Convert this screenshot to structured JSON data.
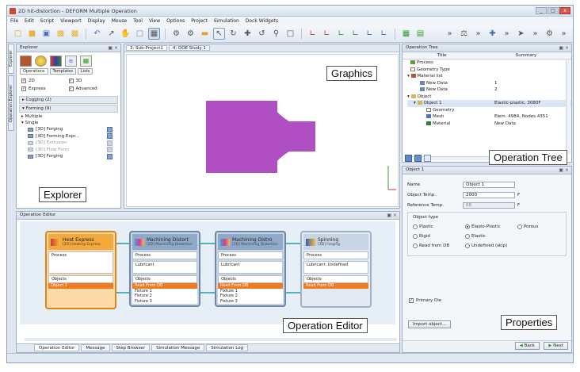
{
  "window": {
    "title": "2D hit-distortion - DEFORM Multiple Operation",
    "controls": [
      "_",
      "□",
      "x"
    ]
  },
  "menu": [
    "File",
    "Edit",
    "Script",
    "Viewport",
    "Display",
    "Mouse",
    "Tool",
    "View",
    "Options",
    "Project",
    "Simulation",
    "Dock Widgets"
  ],
  "toolbar": {
    "icons": [
      "new-icon",
      "open-icon",
      "save-icon",
      "folder-icon",
      "folder-icon",
      "undo-icon",
      "pointer-icon",
      "pan-icon",
      "zoom-icon",
      "display-icon",
      "gear-icon",
      "settings-icon",
      "rect-icon",
      "select-icon",
      "rotate-icon",
      "move-icon",
      "rotate-icon",
      "zoom-icon",
      "fit-icon",
      "axis-icon",
      "axis-icon",
      "axis-icon",
      "axis-icon",
      "axis-icon",
      "axis-icon",
      "grid-icon",
      "grid-icon",
      "chevron-icon",
      "tool-icon",
      "chevron-icon",
      "target-icon",
      "chevron-icon",
      "tool-icon",
      "chevron-icon",
      "gear-icon",
      "chevron-icon"
    ]
  },
  "explorer": {
    "title": "Explorer",
    "side_tabs": [
      "Explorer",
      "Operation Explorer"
    ],
    "tabs": [
      "Operations",
      "Templates",
      "Lists"
    ],
    "checks": [
      {
        "label": "2D",
        "checked": true
      },
      {
        "label": "3D",
        "checked": true
      },
      {
        "label": "Express",
        "checked": true
      },
      {
        "label": "Advanced",
        "checked": true
      }
    ],
    "groups": [
      {
        "label": "Cogging (2)",
        "expanded": false
      },
      {
        "label": "Forming (9)",
        "expanded": true
      }
    ],
    "tree": [
      {
        "label": "Multiple",
        "level": 1
      },
      {
        "label": "Single",
        "level": 1
      }
    ],
    "items": [
      "[3D] Forging",
      "[3D] Forming Expr...",
      "[3D] Extrusion",
      "[3D] Flow Form",
      "[3D] Forging"
    ],
    "callout": "Explorer"
  },
  "graphics": {
    "tabs": [
      "3: Sub-Project1",
      "4: DOE Study 1"
    ],
    "callout": "Graphics",
    "shape_color": "#b04fc4"
  },
  "operation_tree": {
    "title": "Operation Tree",
    "columns": [
      "Title",
      "Summary"
    ],
    "rows": [
      {
        "name": "Process",
        "value": ""
      },
      {
        "name": "Geometry Type",
        "value": ""
      },
      {
        "name": "Material list",
        "value": ""
      },
      {
        "name": "New Data",
        "value": "1"
      },
      {
        "name": "New Data",
        "value": "2"
      },
      {
        "name": "Object",
        "value": ""
      },
      {
        "name": "Object 1",
        "value": "Elastic-plastic, 3080F"
      },
      {
        "name": "Geometry",
        "value": ""
      },
      {
        "name": "Mesh",
        "value": "Elem. 4984, Nodes 4351"
      },
      {
        "name": "Material",
        "value": "New Data"
      }
    ],
    "callout": "Operation Tree"
  },
  "properties": {
    "title": "Object 1",
    "fields": [
      {
        "label": "Name",
        "value": "Object 1"
      },
      {
        "label": "Object Temp.",
        "value": "2000",
        "unit": "F"
      },
      {
        "label": "Reference Temp.",
        "value": "68",
        "unit": "F"
      }
    ],
    "object_type_label": "Object type",
    "radios": [
      {
        "label": "Plastic",
        "selected": false
      },
      {
        "label": "Elasto-Plastic",
        "selected": true
      },
      {
        "label": "Porous",
        "selected": false
      },
      {
        "label": "Rigid",
        "selected": false
      },
      {
        "label": "Elastic",
        "selected": false
      },
      {
        "label": "Read from DB",
        "selected": false
      },
      {
        "label": "Undefined (skip)",
        "selected": false
      }
    ],
    "primary_die": "Primary Die",
    "import_button": "Import object...",
    "back_button": "Back",
    "next_button": "Next",
    "callout": "Properties"
  },
  "operation_editor": {
    "title": "Operation Editor",
    "callout": "Operation Editor",
    "nodes": [
      {
        "title": "Heat Express",
        "subtitle": "[2D] Heating Express",
        "process": "Process",
        "lubricant": "",
        "objects_label": "Objects",
        "objects": [
          "Object 1"
        ],
        "highlight": 0,
        "color": "#f3a93b",
        "border": "#d8881a"
      },
      {
        "title": "Machining Distort",
        "subtitle": "[2D] Machining Distortion",
        "process": "Process",
        "lubricant": "Lubricant",
        "objects_label": "Objects",
        "objects": [
          "Read From DB",
          "Fixture 1",
          "Fixture 2",
          "Fixture 3"
        ],
        "highlight": 0,
        "color": "#8fa9c8",
        "border": "#6d87a8"
      },
      {
        "title": "Machining Distro",
        "subtitle": "[2D] Machining Distortion",
        "process": "Process",
        "lubricant": "Lubricant",
        "objects_label": "Objects",
        "objects": [
          "Read From DB",
          "Fixture 1",
          "Fixture 2",
          "Fixture 3"
        ],
        "highlight": 0,
        "color": "#8fa9c8",
        "border": "#6d87a8"
      },
      {
        "title": "Spinning",
        "subtitle": "[3D] Forging",
        "process": "Process",
        "lubricant": "Lubricant: Undefined",
        "objects_label": "Objects",
        "objects": [
          "Read From DB"
        ],
        "highlight": 0,
        "color": "#c6d4e3",
        "border": "#9fb1c7"
      }
    ]
  },
  "bottom_tabs": [
    "Operation Editor",
    "Message",
    "Step Browser",
    "Simulation Message",
    "Simulation Log"
  ]
}
